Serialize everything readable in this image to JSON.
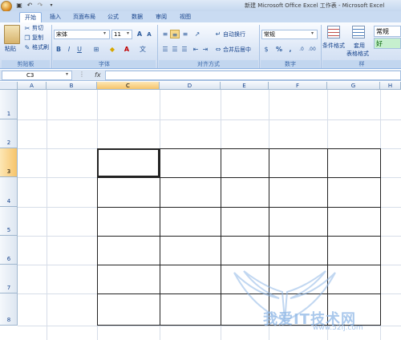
{
  "window_title": "新建 Microsoft Office Excel 工作表 - Microsoft Excel",
  "quick_access": {
    "save_icon": "save-icon",
    "undo_icon": "undo-icon",
    "redo_icon": "redo-icon",
    "dropdown_icon": "customize-qat-icon"
  },
  "tabs": [
    "开始",
    "插入",
    "页面布局",
    "公式",
    "数据",
    "审阅",
    "视图"
  ],
  "active_tab": "开始",
  "clipboard": {
    "paste": "粘贴",
    "cut": "剪切",
    "copy": "复制",
    "format_painter": "格式刷",
    "label": "剪贴板"
  },
  "font": {
    "name": "宋体",
    "size": "11",
    "grow": "A",
    "shrink": "A",
    "bold": "B",
    "italic": "I",
    "underline": "U",
    "label": "字体"
  },
  "alignment": {
    "wrap_text": "自动换行",
    "merge_center": "合并后居中",
    "label": "对齐方式"
  },
  "number": {
    "format": "常规",
    "percent": "%",
    "comma": ",",
    "label": "数字"
  },
  "styles": {
    "conditional_format": "条件格式",
    "table_format_1": "套用",
    "table_format_2": "表格格式",
    "style_normal": "常规",
    "style_good": "好",
    "label": "样"
  },
  "formula_bar": {
    "name_box": "C3",
    "fx": "fx",
    "content": ""
  },
  "columns": [
    "A",
    "B",
    "C",
    "D",
    "E",
    "F",
    "G",
    "H"
  ],
  "rows": [
    "1",
    "2",
    "3",
    "4",
    "5",
    "6",
    "7",
    "8"
  ],
  "selected_cell": "C3",
  "watermark": {
    "text": "我爱IT技术网",
    "url": "www.52ij.com"
  },
  "colors": {
    "ribbon": "#dbe6f6",
    "tab_strip": "#c9dbf2",
    "selected_header": "#f6c46b",
    "gridline": "#d6dde8",
    "table_border": "#222222"
  }
}
